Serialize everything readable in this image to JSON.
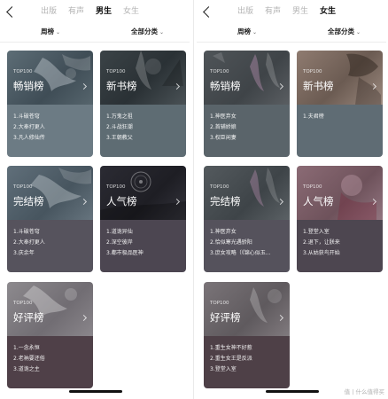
{
  "screens": [
    {
      "tabs": [
        {
          "label": "出版",
          "active": false
        },
        {
          "label": "有声",
          "active": false
        },
        {
          "label": "男生",
          "active": true
        },
        {
          "label": "女生",
          "active": false
        }
      ],
      "filters": {
        "period": "周榜",
        "category": "全部分类"
      },
      "cards": [
        {
          "badge": "TOP100",
          "name": "畅销榜",
          "items": [
            "1.斗破苍穹",
            "2.大奉打更人",
            "3.凡人修仙传"
          ]
        },
        {
          "badge": "TOP100",
          "name": "新书榜",
          "items": [
            "1.万鬼之祖",
            "2.斗战狂潮",
            "3.王朝教父"
          ]
        },
        {
          "badge": "TOP100",
          "name": "完结榜",
          "items": [
            "1.斗破苍穹",
            "2.大奉打更人",
            "3.庆余年"
          ]
        },
        {
          "badge": "TOP100",
          "name": "人气榜",
          "items": [
            "1.道诡异仙",
            "2.深空彼岸",
            "3.都市极品医神"
          ]
        },
        {
          "badge": "TOP100",
          "name": "好评榜",
          "items": [
            "1.一念永恒",
            "2.老衲要还俗",
            "3.道诡之主"
          ]
        }
      ]
    },
    {
      "tabs": [
        {
          "label": "出版",
          "active": false
        },
        {
          "label": "有声",
          "active": false
        },
        {
          "label": "男生",
          "active": false
        },
        {
          "label": "女生",
          "active": true
        }
      ],
      "filters": {
        "period": "周榜",
        "category": "全部分类"
      },
      "cards": [
        {
          "badge": "TOP100",
          "name": "畅销榜",
          "items": [
            "1.神医弃女",
            "2.首辅娇娘",
            "3.权臣闲妻"
          ]
        },
        {
          "badge": "TOP100",
          "name": "新书榜",
          "items": [
            "1.夫君榜"
          ]
        },
        {
          "badge": "TOP100",
          "name": "完结榜",
          "items": [
            "1.神医弃女",
            "2.恰似寒光遇骄阳",
            "3.庶女攻略（《锦心似玉..."
          ]
        },
        {
          "badge": "TOP100",
          "name": "人气榜",
          "items": [
            "1.登堂入室",
            "2.退下，让朕来",
            "3.从姑获鸟开始"
          ]
        },
        {
          "badge": "TOP100",
          "name": "好评榜",
          "items": [
            "1.重生女神不好惹",
            "2.重生女王是反派",
            "3.登堂入室"
          ]
        }
      ]
    }
  ],
  "watermark": "值 | 什么值得买"
}
